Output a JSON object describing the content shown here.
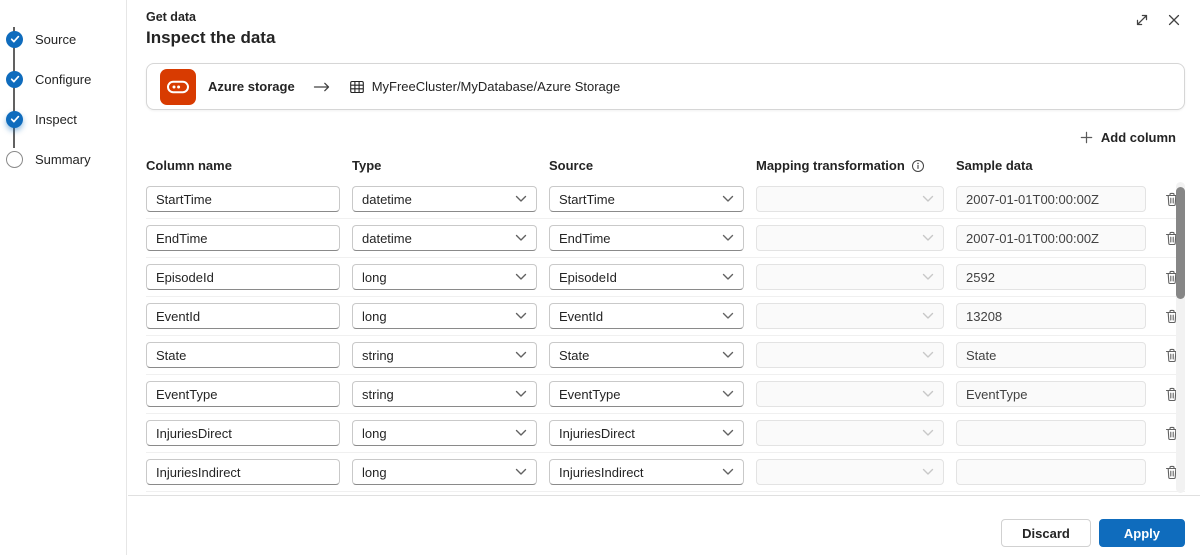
{
  "dialog": {
    "eyebrow": "Get data",
    "title": "Inspect the data"
  },
  "stepper": {
    "items": [
      {
        "label": "Source",
        "state": "complete"
      },
      {
        "label": "Configure",
        "state": "complete"
      },
      {
        "label": "Inspect",
        "state": "active"
      },
      {
        "label": "Summary",
        "state": "upcoming"
      }
    ]
  },
  "source_card": {
    "source_name": "Azure storage",
    "destination": "MyFreeCluster/MyDatabase/Azure Storage"
  },
  "toolbar": {
    "add_column_label": "Add column"
  },
  "table": {
    "headers": {
      "column_name": "Column name",
      "type": "Type",
      "source": "Source",
      "mapping": "Mapping transformation",
      "sample": "Sample data"
    },
    "rows": [
      {
        "name": "StartTime",
        "type": "datetime",
        "source": "StartTime",
        "mapping": "",
        "sample": "2007-01-01T00:00:00Z"
      },
      {
        "name": "EndTime",
        "type": "datetime",
        "source": "EndTime",
        "mapping": "",
        "sample": "2007-01-01T00:00:00Z"
      },
      {
        "name": "EpisodeId",
        "type": "long",
        "source": "EpisodeId",
        "mapping": "",
        "sample": "2592"
      },
      {
        "name": "EventId",
        "type": "long",
        "source": "EventId",
        "mapping": "",
        "sample": "13208"
      },
      {
        "name": "State",
        "type": "string",
        "source": "State",
        "mapping": "",
        "sample": "State"
      },
      {
        "name": "EventType",
        "type": "string",
        "source": "EventType",
        "mapping": "",
        "sample": "EventType"
      },
      {
        "name": "InjuriesDirect",
        "type": "long",
        "source": "InjuriesDirect",
        "mapping": "",
        "sample": ""
      },
      {
        "name": "InjuriesIndirect",
        "type": "long",
        "source": "InjuriesIndirect",
        "mapping": "",
        "sample": ""
      }
    ]
  },
  "footer": {
    "discard_label": "Discard",
    "apply_label": "Apply"
  },
  "icons": {
    "expand": "diagonal-expand-icon",
    "close": "close-icon",
    "add": "plus-icon",
    "info": "info-icon",
    "delete": "trash-icon",
    "dropdown": "chevron-down-icon",
    "source": "azure-storage-icon",
    "destination": "table-grid-icon",
    "flow": "arrow-right-icon"
  },
  "colors": {
    "primary": "#0f6cbd",
    "storage_icon": "#d83b01",
    "step_complete": "#0f6cbd"
  }
}
